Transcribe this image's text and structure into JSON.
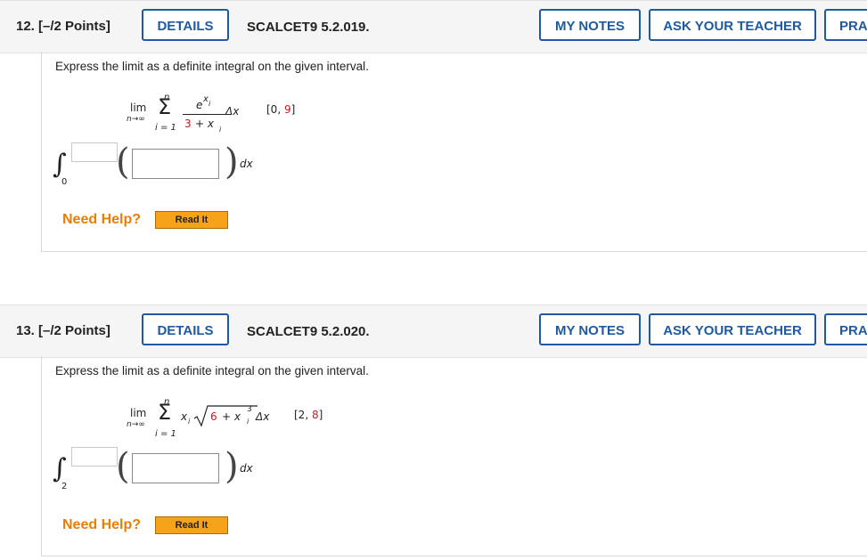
{
  "questions": [
    {
      "number": "12.",
      "points": "[–/2 Points]",
      "details": "DETAILS",
      "code": "SCALCET9 5.2.019.",
      "my_notes": "MY NOTES",
      "ask_teacher": "ASK YOUR TEACHER",
      "practice": "PRA",
      "prompt": "Express the limit as a definite integral on the given interval.",
      "limit": {
        "lim": "lim",
        "sub": "n→∞",
        "sum_top": "n",
        "sum_bottom": "i = 1",
        "numerator": "e",
        "numerator_sup": "x",
        "numerator_sub": "i",
        "denominator_const": "3",
        "denominator_rest": "+ x",
        "denominator_sub": "i",
        "delta": "Δx"
      },
      "interval_open": "[0,",
      "interval_end": "9",
      "interval_close": "]",
      "lower_limit": "0",
      "dx": "dx",
      "need_help": "Need Help?",
      "read_it": "Read It"
    },
    {
      "number": "13.",
      "points": "[–/2 Points]",
      "details": "DETAILS",
      "code": "SCALCET9 5.2.020.",
      "my_notes": "MY NOTES",
      "ask_teacher": "ASK YOUR TEACHER",
      "practice": "PRA",
      "prompt": "Express the limit as a definite integral on the given interval.",
      "limit": {
        "lim": "lim",
        "sub": "n→∞",
        "sum_top": "n",
        "sum_bottom": "i = 1",
        "factor": "x",
        "factor_sub": "i",
        "radical_const": "6",
        "radical_rest": "+ x",
        "radical_sup": "3",
        "radical_sub": "i",
        "delta": "Δx"
      },
      "interval_open": "[2,",
      "interval_end": "8",
      "interval_close": "]",
      "lower_limit": "2",
      "dx": "dx",
      "need_help": "Need Help?",
      "read_it": "Read It"
    }
  ]
}
